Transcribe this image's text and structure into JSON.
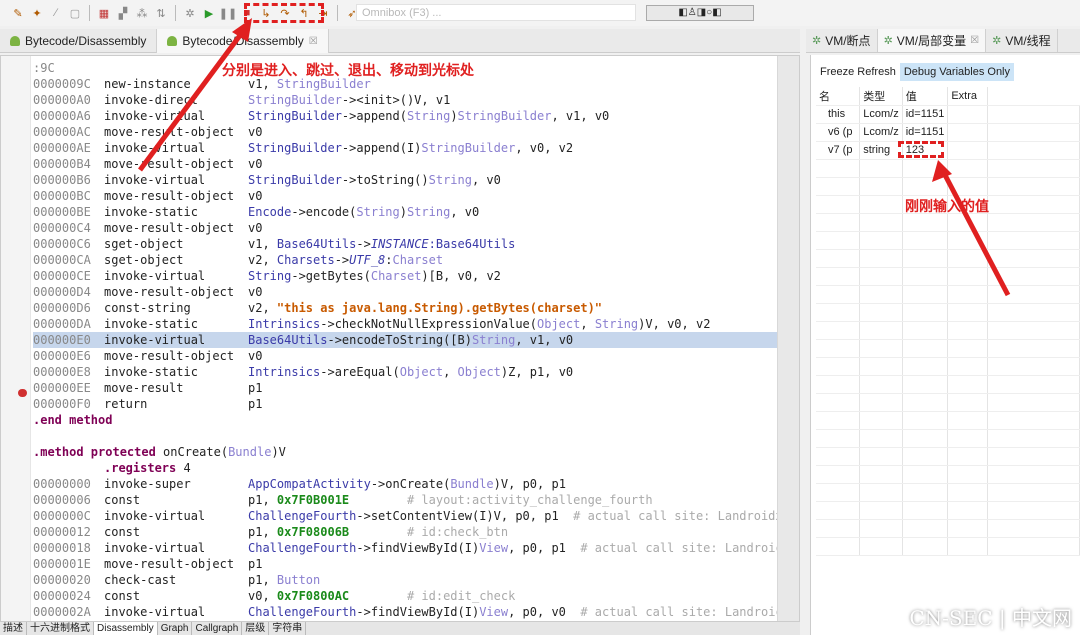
{
  "toolbar": {
    "omnibox_placeholder": "Omnibox (F3) ...",
    "debug_buttons": [
      "step-into",
      "step-over",
      "step-out",
      "run-to-cursor"
    ]
  },
  "editor_tabs": [
    {
      "label": "Bytecode/Disassembly"
    },
    {
      "label": "Bytecode/Disassembly",
      "close": "☒"
    }
  ],
  "code": {
    "rows": [
      {
        "addr": "",
        "op": ":9C",
        "args": []
      },
      {
        "addr": "0000009C",
        "op": "new-instance",
        "args": [
          [
            "v1, ",
            "t"
          ],
          [
            "StringBuilder",
            "p"
          ]
        ]
      },
      {
        "addr": "000000A0",
        "op": "invoke-direct",
        "args": [
          [
            "StringBuilder",
            "p"
          ],
          [
            "-><init>()V, v1",
            "t"
          ]
        ]
      },
      {
        "addr": "000000A6",
        "op": "invoke-virtual",
        "args": [
          [
            "StringBuilder",
            "c"
          ],
          [
            "->append(",
            "t"
          ],
          [
            "String",
            "p"
          ],
          [
            ")",
            "t"
          ],
          [
            "StringBuilder",
            "p"
          ],
          [
            ", v1, v0",
            "t"
          ]
        ]
      },
      {
        "addr": "000000AC",
        "op": "move-result-object",
        "args": [
          [
            "v0",
            "t"
          ]
        ]
      },
      {
        "addr": "000000AE",
        "op": "invoke-virtual",
        "args": [
          [
            "StringBuilder",
            "c"
          ],
          [
            "->append(I)",
            "t"
          ],
          [
            "StringBuilder",
            "p"
          ],
          [
            ", v0, v2",
            "t"
          ]
        ]
      },
      {
        "addr": "000000B4",
        "op": "move-result-object",
        "args": [
          [
            "v0",
            "t"
          ]
        ]
      },
      {
        "addr": "000000B6",
        "op": "invoke-virtual",
        "args": [
          [
            "StringBuilder",
            "c"
          ],
          [
            "->toString()",
            "t"
          ],
          [
            "String",
            "p"
          ],
          [
            ", v0",
            "t"
          ]
        ]
      },
      {
        "addr": "000000BC",
        "op": "move-result-object",
        "args": [
          [
            "v0",
            "t"
          ]
        ]
      },
      {
        "addr": "000000BE",
        "op": "invoke-static",
        "args": [
          [
            "Encode",
            "c"
          ],
          [
            "->encode(",
            "t"
          ],
          [
            "String",
            "p"
          ],
          [
            ")",
            "t"
          ],
          [
            "String",
            "p"
          ],
          [
            ", v0",
            "t"
          ]
        ]
      },
      {
        "addr": "000000C4",
        "op": "move-result-object",
        "args": [
          [
            "v0",
            "t"
          ]
        ]
      },
      {
        "addr": "000000C6",
        "op": "sget-object",
        "args": [
          [
            "v1, ",
            "t"
          ],
          [
            "Base64Utils",
            "c"
          ],
          [
            "->",
            "t"
          ],
          [
            "INSTANCE",
            "i"
          ],
          [
            ":Base64Utils",
            "c"
          ]
        ]
      },
      {
        "addr": "000000CA",
        "op": "sget-object",
        "args": [
          [
            "v2, ",
            "t"
          ],
          [
            "Charsets",
            "c"
          ],
          [
            "->",
            "t"
          ],
          [
            "UTF_8",
            "i"
          ],
          [
            ":",
            "t"
          ],
          [
            "Charset",
            "p"
          ]
        ]
      },
      {
        "addr": "000000CE",
        "op": "invoke-virtual",
        "args": [
          [
            "String",
            "c"
          ],
          [
            "->getBytes(",
            "t"
          ],
          [
            "Charset",
            "p"
          ],
          [
            ")[B, v0, v2",
            "t"
          ]
        ]
      },
      {
        "addr": "000000D4",
        "op": "move-result-object",
        "args": [
          [
            "v0",
            "t"
          ]
        ]
      },
      {
        "addr": "000000D6",
        "op": "const-string",
        "args": [
          [
            "v2, ",
            "t"
          ],
          [
            "\"this as java.lang.String).getBytes(charset)\"",
            "s"
          ]
        ]
      },
      {
        "addr": "000000DA",
        "op": "invoke-static",
        "args": [
          [
            "Intrinsics",
            "c"
          ],
          [
            "->checkNotNullExpressionValue(",
            "t"
          ],
          [
            "Object",
            "p"
          ],
          [
            ", ",
            "t"
          ],
          [
            "String",
            "p"
          ],
          [
            ")V, v0, v2",
            "t"
          ]
        ]
      },
      {
        "addr": "000000E0",
        "op": "invoke-virtual",
        "args": [
          [
            "Base64Utils",
            "c"
          ],
          [
            "->encodeToString([B)",
            "t"
          ],
          [
            "String",
            "p"
          ],
          [
            ", v1, v0",
            "t"
          ]
        ],
        "highlighted": true
      },
      {
        "addr": "000000E6",
        "op": "move-result-object",
        "args": [
          [
            "v0",
            "t"
          ]
        ]
      },
      {
        "addr": "000000E8",
        "op": "invoke-static",
        "args": [
          [
            "Intrinsics",
            "c"
          ],
          [
            "->areEqual(",
            "t"
          ],
          [
            "Object",
            "p"
          ],
          [
            ", ",
            "t"
          ],
          [
            "Object",
            "p"
          ],
          [
            ")Z, p1, v0",
            "t"
          ]
        ]
      },
      {
        "addr": "000000EE",
        "op": "move-result",
        "args": [
          [
            "p1",
            "t"
          ]
        ]
      },
      {
        "addr": "000000F0",
        "op": "return",
        "args": [
          [
            "p1",
            "t"
          ]
        ]
      },
      {
        "addr": "",
        "op": ".end method",
        "args": [],
        "kw": true
      },
      {
        "addr": "",
        "op": "",
        "args": []
      },
      {
        "addr": "",
        "op": ".method protected",
        "args": [],
        "kw": true,
        "tail": [
          [
            " onCreate(",
            "t"
          ],
          [
            "Bundle",
            "p"
          ],
          [
            ")V",
            "t"
          ]
        ]
      },
      {
        "addr": "",
        "op": "",
        "args": [
          [
            "",
            "t"
          ]
        ],
        "reg": ".registers",
        "regval": " 4"
      },
      {
        "addr": "00000000",
        "op": "invoke-super",
        "args": [
          [
            "AppCompatActivity",
            "c"
          ],
          [
            "->onCreate(",
            "t"
          ],
          [
            "Bundle",
            "p"
          ],
          [
            ")V, p0, p1",
            "t"
          ]
        ]
      },
      {
        "addr": "00000006",
        "op": "const",
        "args": [
          [
            "p1, ",
            "t"
          ],
          [
            "0x7F0B001E",
            "n"
          ],
          [
            "        # layout:activity_challenge_fourth",
            "cm"
          ]
        ]
      },
      {
        "addr": "0000000C",
        "op": "invoke-virtual",
        "args": [
          [
            "ChallengeFourth",
            "c"
          ],
          [
            "->setContentView(I)V, p0, p1",
            "t"
          ],
          [
            "  # actual call site: Landroidx",
            "cm"
          ]
        ]
      },
      {
        "addr": "00000012",
        "op": "const",
        "args": [
          [
            "p1, ",
            "t"
          ],
          [
            "0x7F08006B",
            "n"
          ],
          [
            "        # id:check_btn",
            "cm"
          ]
        ]
      },
      {
        "addr": "00000018",
        "op": "invoke-virtual",
        "args": [
          [
            "ChallengeFourth",
            "c"
          ],
          [
            "->findViewById(I)",
            "t"
          ],
          [
            "View",
            "p"
          ],
          [
            ", p0, p1",
            "t"
          ],
          [
            "  # actual call site: Landroic",
            "cm"
          ]
        ]
      },
      {
        "addr": "0000001E",
        "op": "move-result-object",
        "args": [
          [
            "p1",
            "t"
          ]
        ]
      },
      {
        "addr": "00000020",
        "op": "check-cast",
        "args": [
          [
            "p1, ",
            "t"
          ],
          [
            "Button",
            "p"
          ]
        ]
      },
      {
        "addr": "00000024",
        "op": "const",
        "args": [
          [
            "v0, ",
            "t"
          ],
          [
            "0x7F0800AC",
            "n"
          ],
          [
            "        # id:edit_check",
            "cm"
          ]
        ]
      },
      {
        "addr": "0000002A",
        "op": "invoke-virtual",
        "args": [
          [
            "ChallengeFourth",
            "c"
          ],
          [
            "->findViewById(I)",
            "t"
          ],
          [
            "View",
            "p"
          ],
          [
            ", p0, v0",
            "t"
          ],
          [
            "  # actual call site: Landroic",
            "cm"
          ]
        ]
      }
    ]
  },
  "bottom_tabs": [
    "描述",
    "十六进制格式",
    "Disassembly",
    "Graph",
    "Callgraph",
    "层级",
    "字符串"
  ],
  "right_tabs": [
    {
      "label": "VM/断点"
    },
    {
      "label": "VM/局部变量",
      "close": "☒"
    },
    {
      "label": "VM/线程"
    }
  ],
  "locals": {
    "freeze_label": "Freeze Refresh",
    "debug_only_label": "Debug Variables Only",
    "columns": [
      "名",
      "类型",
      "值",
      "Extra"
    ],
    "rows": [
      [
        "this",
        "Lcom/z",
        "id=1151",
        ""
      ],
      [
        "v6 (p",
        "Lcom/z",
        "id=1151",
        ""
      ],
      [
        "v7 (p",
        "string",
        "123",
        ""
      ]
    ]
  },
  "annotations": {
    "toolbar_note": "分别是进入、跳过、退出、移动到光标处",
    "value_note": "刚刚输入的值",
    "color": "#e02020"
  },
  "watermark": "CN-SEC | 中文网"
}
